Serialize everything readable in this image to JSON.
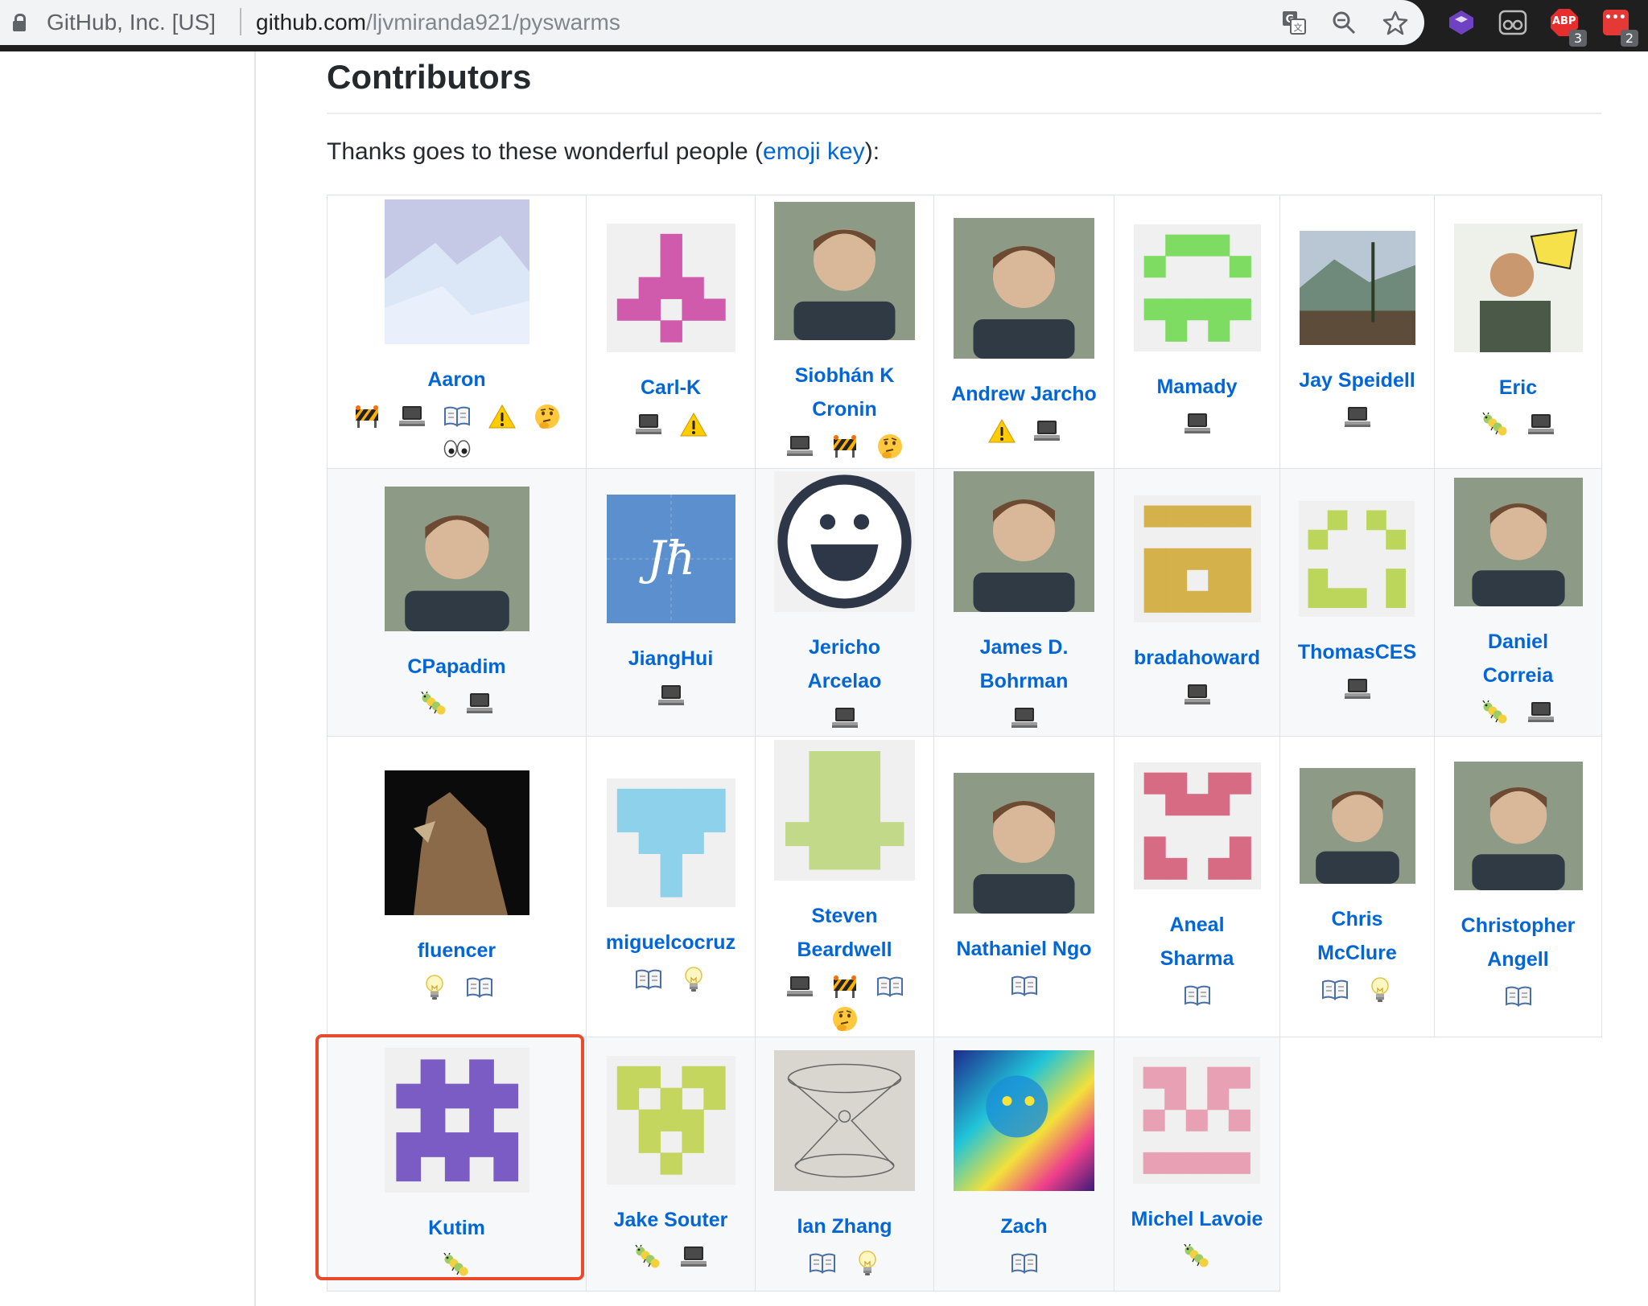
{
  "browser": {
    "site_identity": "GitHub, Inc. [US]",
    "url_host": "github.com",
    "url_path": "/ljvmiranda921/pyswarms",
    "abp_badge": "3",
    "ext_badge": "2",
    "abp_label": "ABP",
    "ext_dots": "•••"
  },
  "section": {
    "title": "Contributors",
    "intro_prefix": "Thanks goes to these wonderful people (",
    "intro_link": "emoji key",
    "intro_suffix": "):"
  },
  "contributors": [
    {
      "name": "Aaron",
      "avatar": "photo-icebergs",
      "contributions": [
        "infra",
        "code",
        "doc",
        "test",
        "question",
        "review"
      ]
    },
    {
      "name": "Carl-K",
      "avatar": "identicon-pink",
      "contributions": [
        "code",
        "test"
      ]
    },
    {
      "name": "Siobhán K Cronin",
      "avatar": "photo-portrait",
      "contributions": [
        "code",
        "infra",
        "question"
      ]
    },
    {
      "name": "Andrew Jarcho",
      "avatar": "photo-portrait",
      "contributions": [
        "test",
        "code"
      ]
    },
    {
      "name": "Mamady",
      "avatar": "identicon-green",
      "contributions": [
        "code"
      ]
    },
    {
      "name": "Jay Speidell",
      "avatar": "photo-landscape",
      "contributions": [
        "code"
      ]
    },
    {
      "name": "Eric",
      "avatar": "photo-wow",
      "contributions": [
        "bug",
        "code"
      ]
    },
    {
      "name": "CPapadim",
      "avatar": "photo-portrait",
      "contributions": [
        "bug",
        "code"
      ]
    },
    {
      "name": "JiangHui",
      "avatar": "jh-logo",
      "contributions": [
        "code"
      ]
    },
    {
      "name": "Jericho Arcelao",
      "avatar": "smiley",
      "contributions": [
        "code"
      ]
    },
    {
      "name": "James D. Bohrman",
      "avatar": "photo-portrait",
      "contributions": [
        "code"
      ]
    },
    {
      "name": "bradahoward",
      "avatar": "identicon-gold",
      "contributions": [
        "code"
      ]
    },
    {
      "name": "ThomasCES",
      "avatar": "identicon-lime",
      "contributions": [
        "code"
      ]
    },
    {
      "name": "Daniel Correia",
      "avatar": "photo-portrait",
      "contributions": [
        "bug",
        "code"
      ]
    },
    {
      "name": "fluencer",
      "avatar": "photo-wolf",
      "contributions": [
        "idea",
        "doc"
      ]
    },
    {
      "name": "miguelcocruz",
      "avatar": "identicon-sky",
      "contributions": [
        "doc",
        "idea"
      ]
    },
    {
      "name": "Steven Beardwell",
      "avatar": "identicon-olive",
      "contributions": [
        "code",
        "infra",
        "doc",
        "question"
      ]
    },
    {
      "name": "Nathaniel Ngo",
      "avatar": "photo-portrait",
      "contributions": [
        "doc"
      ]
    },
    {
      "name": "Aneal Sharma",
      "avatar": "identicon-rose",
      "contributions": [
        "doc"
      ]
    },
    {
      "name": "Chris McClure",
      "avatar": "photo-portrait",
      "contributions": [
        "doc",
        "idea"
      ]
    },
    {
      "name": "Christopher Angell",
      "avatar": "photo-portrait",
      "contributions": [
        "doc"
      ]
    },
    {
      "name": "Kutim",
      "avatar": "identicon-purple",
      "contributions": [
        "bug"
      ]
    },
    {
      "name": "Jake Souter",
      "avatar": "identicon-yellowgreen",
      "contributions": [
        "bug",
        "code"
      ]
    },
    {
      "name": "Ian Zhang",
      "avatar": "photo-sketch",
      "contributions": [
        "doc",
        "idea"
      ]
    },
    {
      "name": "Zach",
      "avatar": "photo-psychedelic-cat",
      "contributions": [
        "doc"
      ]
    },
    {
      "name": "Michel Lavoie",
      "avatar": "identicon-lightpink",
      "contributions": [
        "bug"
      ]
    }
  ],
  "highlighted_contributor": "Kutim",
  "colors": {
    "link": "#0366d6",
    "text": "#24292e",
    "border": "#dfe2e5",
    "alt_row": "#f6f8fa",
    "highlight": "#ea4a2c"
  }
}
